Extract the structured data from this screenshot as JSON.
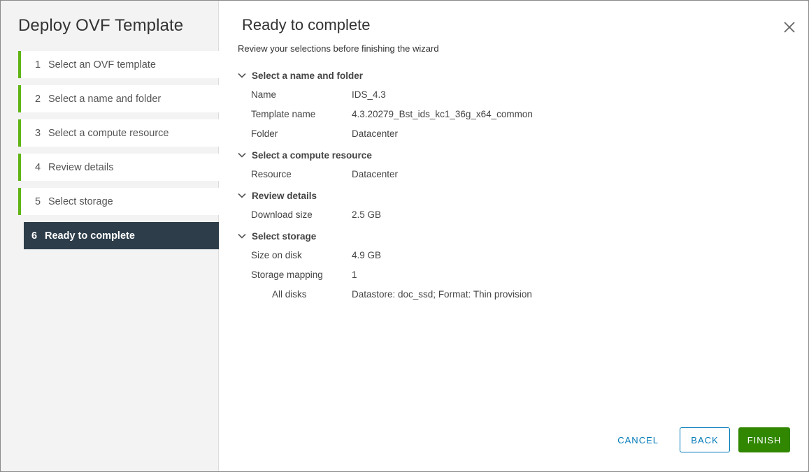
{
  "sidebar": {
    "title": "Deploy OVF Template",
    "steps": [
      {
        "num": "1",
        "label": "Select an OVF template"
      },
      {
        "num": "2",
        "label": "Select a name and folder"
      },
      {
        "num": "3",
        "label": "Select a compute resource"
      },
      {
        "num": "4",
        "label": "Review details"
      },
      {
        "num": "5",
        "label": "Select storage"
      },
      {
        "num": "6",
        "label": "Ready to complete"
      }
    ]
  },
  "main": {
    "title": "Ready to complete",
    "subtitle": "Review your selections before finishing the wizard",
    "sections": [
      {
        "title": "Select a name and folder",
        "rows": [
          {
            "key": "Name",
            "value": "IDS_4.3"
          },
          {
            "key": "Template name",
            "value": "4.3.20279_Bst_ids_kc1_36g_x64_common"
          },
          {
            "key": "Folder",
            "value": "Datacenter"
          }
        ]
      },
      {
        "title": "Select a compute resource",
        "rows": [
          {
            "key": "Resource",
            "value": "Datacenter"
          }
        ]
      },
      {
        "title": "Review details",
        "rows": [
          {
            "key": "Download size",
            "value": "2.5 GB"
          }
        ]
      },
      {
        "title": "Select storage",
        "rows": [
          {
            "key": "Size on disk",
            "value": "4.9 GB"
          },
          {
            "key": "Storage mapping",
            "value": "1"
          },
          {
            "key": "All disks",
            "value": "Datastore: doc_ssd; Format: Thin provision"
          }
        ]
      }
    ]
  },
  "footer": {
    "cancel_label": "CANCEL",
    "back_label": "BACK",
    "finish_label": "FINISH"
  },
  "colors": {
    "accent": "#0079b8",
    "step_complete": "#60b515",
    "active_step_bg": "#2d3e4a",
    "primary_button": "#318700"
  },
  "icons": {
    "close": "close-icon",
    "section_toggle": "chevron-down-icon"
  }
}
